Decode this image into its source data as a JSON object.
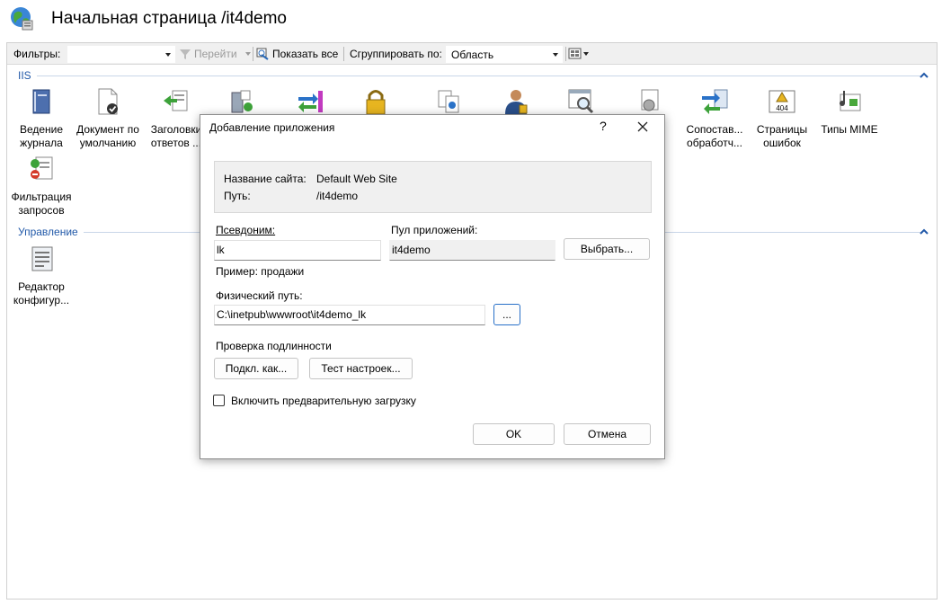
{
  "header": {
    "title": "Начальная страница /it4demo"
  },
  "toolbar": {
    "filter_label": "Фильтры:",
    "filter_value": "",
    "go_label": "Перейти",
    "show_all_label": "Показать все",
    "group_by_label": "Сгруппировать по:",
    "group_by_value": "Область"
  },
  "sections": {
    "iis": {
      "label": "IIS"
    },
    "management": {
      "label": "Управление"
    }
  },
  "features": {
    "logging": {
      "line1": "Ведение",
      "line2": "журнала"
    },
    "default_document": {
      "line1": "Документ по",
      "line2": "умолчанию"
    },
    "headers": {
      "line1": "Заголовки",
      "line2": "ответов ..."
    },
    "mappings": {
      "line1": "Сопостав...",
      "line2": "обработч..."
    },
    "error_pages": {
      "line1": "Страницы",
      "line2": "ошибок",
      "badge": "404"
    },
    "mime": {
      "line1": "Типы MIME"
    },
    "filtering": {
      "line1": "Фильтрация",
      "line2": "запросов"
    },
    "config_editor": {
      "line1": "Редактор",
      "line2": "конфигур..."
    }
  },
  "dialog": {
    "title": "Добавление приложения",
    "help": "?",
    "site_name_label": "Название сайта:",
    "site_name_value": "Default Web Site",
    "path_label": "Путь:",
    "path_value": "/it4demo",
    "alias_label": "Псевдоним:",
    "alias_value": "lk",
    "alias_example": "Пример: продажи",
    "pool_label": "Пул приложений:",
    "pool_value": "it4demo",
    "select_button": "Выбрать...",
    "physical_path_label": "Физический путь:",
    "physical_path_value": "C:\\inetpub\\wwwroot\\it4demo_lk",
    "browse_button": "...",
    "auth_label": "Проверка подлинности",
    "connect_as_button": "Подкл. как...",
    "test_settings_button": "Тест настроек...",
    "preload_label": "Включить предварительную загрузку",
    "preload_checked": false,
    "ok_button": "OK",
    "cancel_button": "Отмена"
  }
}
